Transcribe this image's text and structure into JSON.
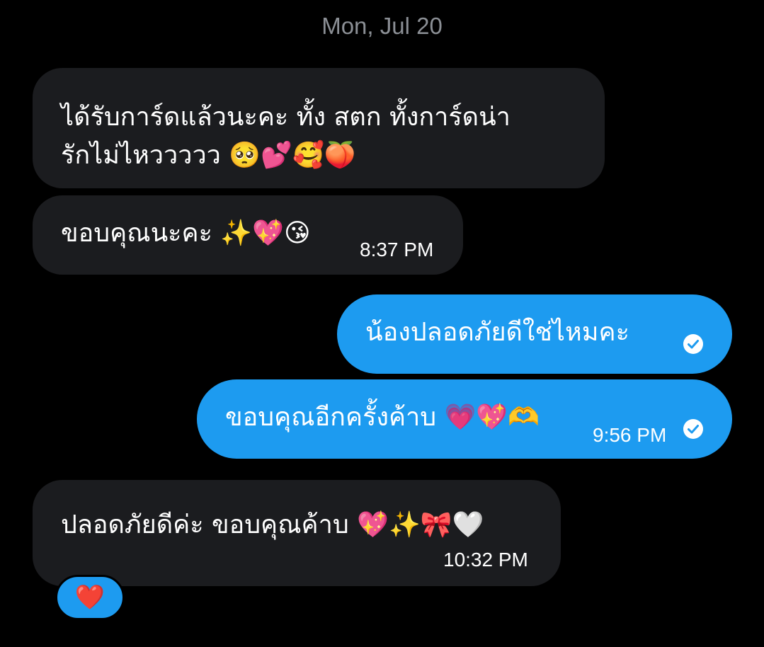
{
  "date_separator": "Mon, Jul 20",
  "messages": [
    {
      "direction": "incoming",
      "lines": [
        "ได้รับการ์ดแล้วนะคะ ทั้ง สตก ทั้งการ์ดน่า",
        "รักไม่ไหววววว 🥺💕🥰🍑"
      ],
      "time": ""
    },
    {
      "direction": "incoming",
      "text": "ขอบคุณนะคะ ✨💖😘",
      "time": "8:37 PM"
    },
    {
      "direction": "outgoing",
      "text": "น้องปลอดภัยดีใช่ไหมคะ",
      "time": "",
      "status": "check-circle-icon"
    },
    {
      "direction": "outgoing",
      "text": "ขอบคุณอีกครั้งค้าบ 💗💖🫶",
      "time": "9:56 PM",
      "status": "check-circle-icon"
    },
    {
      "direction": "incoming",
      "text": "ปลอดภัยดีค่ะ ขอบคุณค้าบ 💖✨🎀🤍",
      "time": "10:32 PM"
    }
  ],
  "reaction": {
    "emoji": "❤️"
  },
  "colors": {
    "background": "#000000",
    "incoming_bubble": "#1b1c1f",
    "outgoing_bubble": "#1d9bf0",
    "date_text": "#8b8f95",
    "text": "#ffffff"
  }
}
